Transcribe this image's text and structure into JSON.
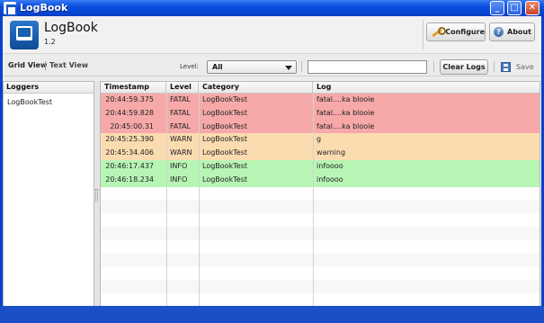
{
  "window": {
    "title": "LogBook"
  },
  "app": {
    "name": "LogBook",
    "version": "1.2"
  },
  "header_buttons": {
    "configure": "Configure",
    "about": "About",
    "help_glyph": "?"
  },
  "toolbar": {
    "grid_view": "Grid View",
    "text_view": "Text View",
    "level_label": "Level:",
    "level_value": "All",
    "search_value": "",
    "clear_logs": "Clear Logs",
    "save": "Save"
  },
  "loggers": {
    "title": "Loggers",
    "items": [
      "LogBookTest"
    ]
  },
  "grid": {
    "columns": [
      "Timestamp",
      "Level",
      "Category",
      "Log"
    ],
    "rows": [
      {
        "timestamp": "20:44:59.375",
        "level": "FATAL",
        "category": "LogBookTest",
        "log": "fatal....ka blooie"
      },
      {
        "timestamp": "20:44:59.828",
        "level": "FATAL",
        "category": "LogBookTest",
        "log": "fatal....ka blooie"
      },
      {
        "timestamp": "20:45:00.31",
        "level": "FATAL",
        "category": "LogBookTest",
        "log": "fatal....ka blooie"
      },
      {
        "timestamp": "20:45:25.390",
        "level": "WARN",
        "category": "LogBookTest",
        "log": "g"
      },
      {
        "timestamp": "20:45:34.406",
        "level": "WARN",
        "category": "LogBookTest",
        "log": "warning"
      },
      {
        "timestamp": "20:46:17.437",
        "level": "INFO",
        "category": "LogBookTest",
        "log": "infoooo"
      },
      {
        "timestamp": "20:46:18.234",
        "level": "INFO",
        "category": "LogBookTest",
        "log": "infoooo"
      }
    ],
    "level_colors": {
      "FATAL": "#f7a9a9",
      "WARN": "#fbdcb0",
      "INFO": "#b7f5b4"
    }
  },
  "icons": {
    "configure": "wrench-icon",
    "about": "help-icon",
    "save": "save-icon",
    "app": "logbook-icon"
  }
}
